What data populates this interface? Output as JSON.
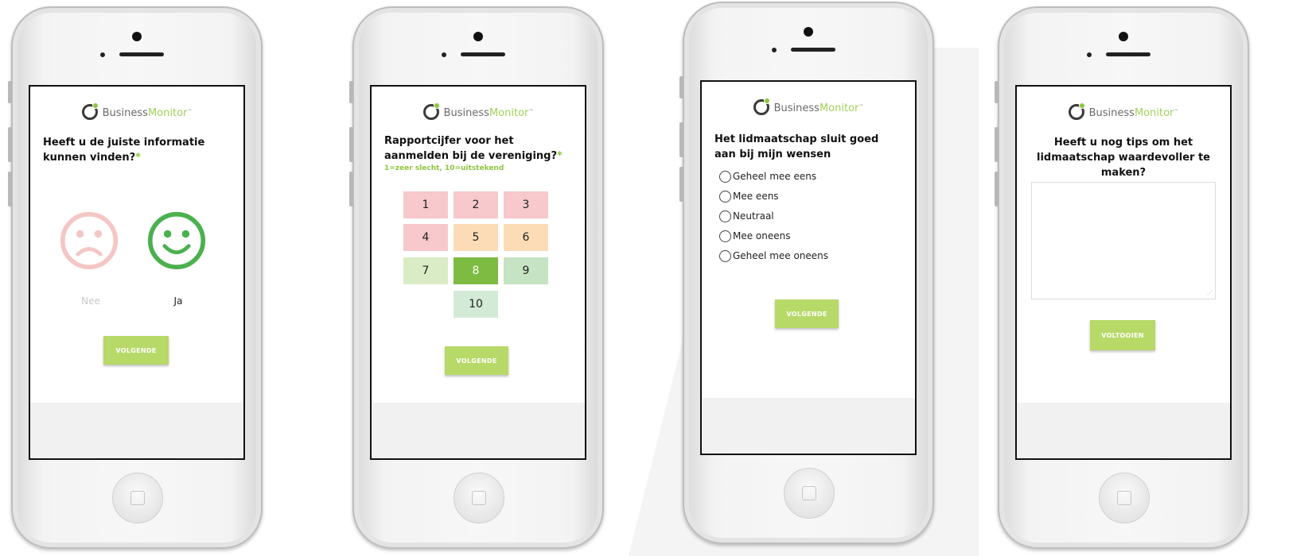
{
  "brand": {
    "name_part1": "Business",
    "name_part2": "Monitor",
    "trademark": "™"
  },
  "colors": {
    "accent_green": "#b7d968",
    "logo_green": "#8dc63f"
  },
  "screen1": {
    "question": "Heeft u de juiste informatie kunnen vinden?",
    "required_mark": "*",
    "options": [
      {
        "label": "Nee",
        "icon": "sad-face-icon"
      },
      {
        "label": "Ja",
        "icon": "happy-face-icon"
      }
    ],
    "button": "VOLGENDE"
  },
  "screen2": {
    "question": "Rapportcijfer voor het aanmelden bij de vereniging?",
    "required_mark": "*",
    "hint": "1=zeer slecht, 10=uitstekend",
    "scores": [
      "1",
      "2",
      "3",
      "4",
      "5",
      "6",
      "7",
      "8",
      "9",
      "10"
    ],
    "selected_score": "8",
    "button": "VOLGENDE"
  },
  "screen3": {
    "question": "Het lidmaatschap sluit goed aan bij mijn wensen",
    "options": [
      "Geheel mee eens",
      "Mee eens",
      "Neutraal",
      "Mee oneens",
      "Geheel mee oneens"
    ],
    "button": "VOLGENDE"
  },
  "screen4": {
    "question": "Heeft u nog tips om het lidmaatschap waardevoller te maken?",
    "textarea_value": "",
    "button": "VOLTOOIEN"
  }
}
